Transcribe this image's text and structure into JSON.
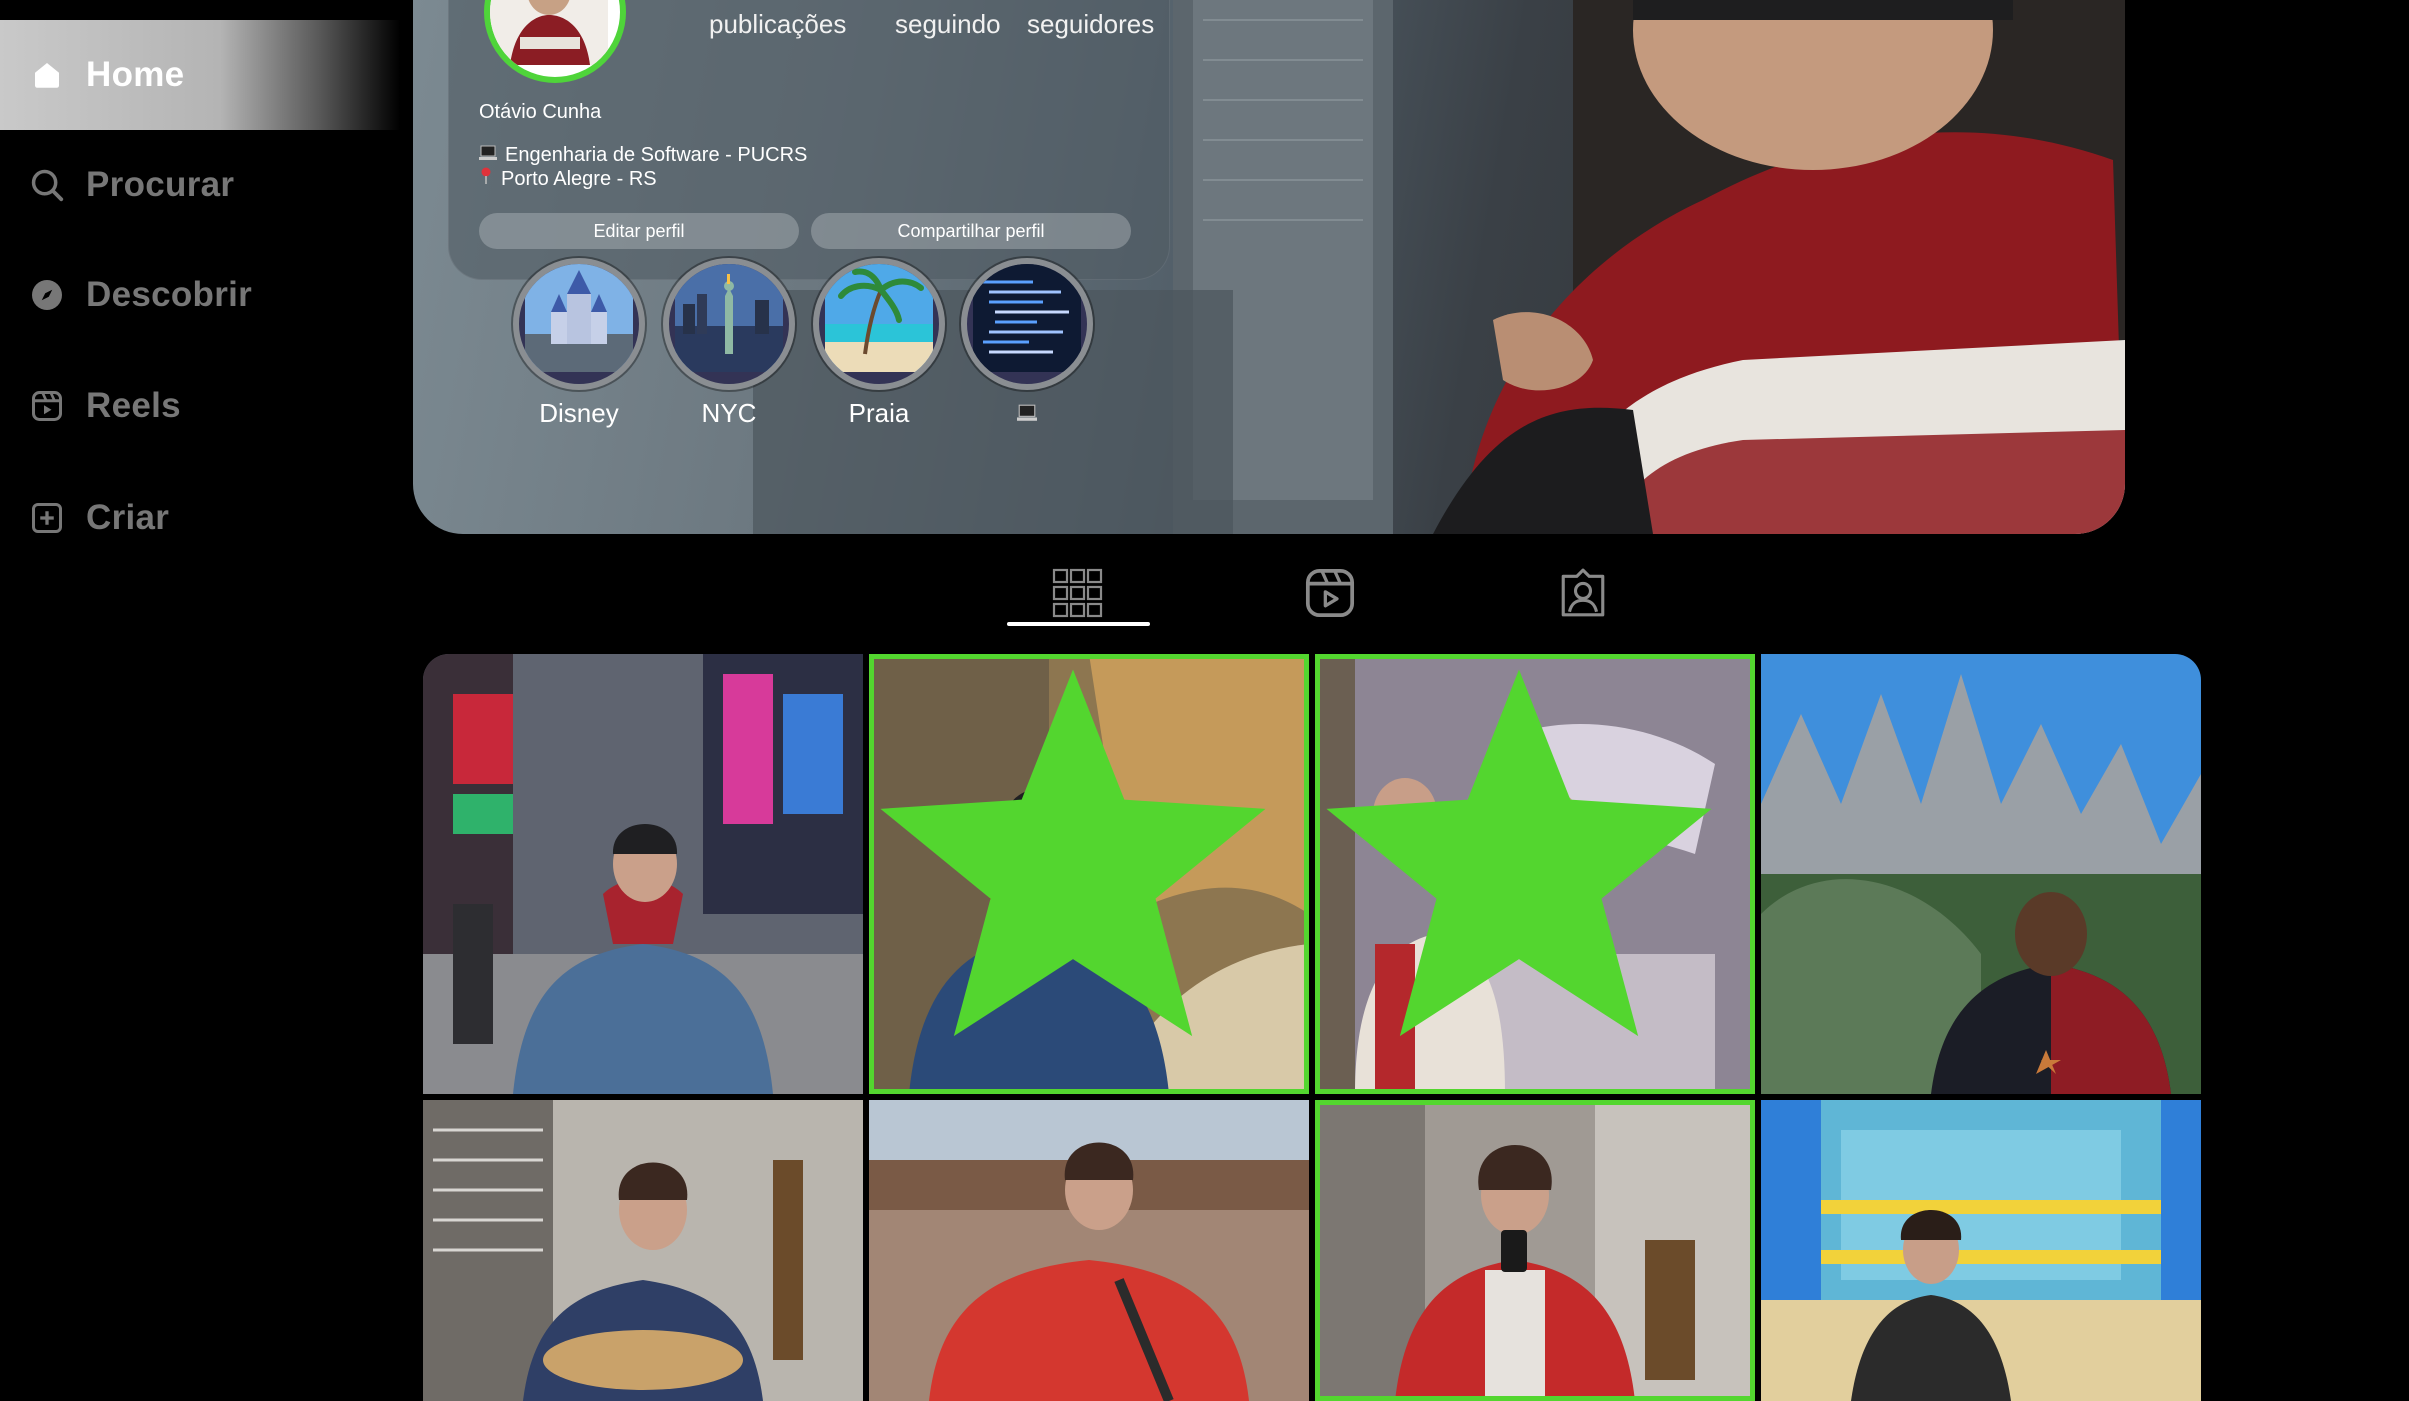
{
  "sidebar": {
    "items": [
      {
        "label": "Home",
        "icon": "home-icon"
      },
      {
        "label": "Procurar",
        "icon": "search-icon"
      },
      {
        "label": "Descobrir",
        "icon": "compass-icon"
      },
      {
        "label": "Reels",
        "icon": "reels-icon"
      },
      {
        "label": "Criar",
        "icon": "plus-square-icon"
      }
    ]
  },
  "profile": {
    "stats": {
      "posts_label": "publicações",
      "following_label": "seguindo",
      "followers_label": "seguidores"
    },
    "name": "Otávio Cunha",
    "bio": [
      {
        "emoji": "laptop-emoji",
        "text": "Engenharia de Software - PUCRS"
      },
      {
        "emoji": "pin-emoji",
        "text": "Porto Alegre - RS"
      }
    ],
    "buttons": {
      "edit": "Editar perfil",
      "share": "Compartilhar perfil"
    },
    "highlights": [
      {
        "label": "Disney"
      },
      {
        "label": "NYC"
      },
      {
        "label": "Praia"
      },
      {
        "label": ""
      }
    ]
  },
  "tabs": [
    {
      "icon": "grid-icon",
      "active": true
    },
    {
      "icon": "reels-icon",
      "active": false
    },
    {
      "icon": "tagged-icon",
      "active": false
    }
  ],
  "posts": [
    {
      "favorite": false
    },
    {
      "favorite": true
    },
    {
      "favorite": true
    },
    {
      "favorite": false
    },
    {
      "favorite": false
    },
    {
      "favorite": false
    },
    {
      "favorite": true
    },
    {
      "favorite": false
    }
  ],
  "colors": {
    "accent_green": "#53d62f",
    "background": "#000000",
    "inactive_nav": "#777777"
  }
}
